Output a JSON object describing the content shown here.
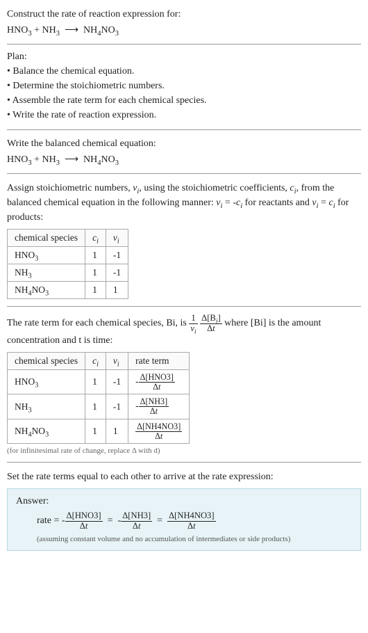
{
  "header": {
    "prompt": "Construct the rate of reaction expression for:",
    "equation": "HNO3 + NH3 ⟶ NH4NO3"
  },
  "plan": {
    "title": "Plan:",
    "items": [
      "Balance the chemical equation.",
      "Determine the stoichiometric numbers.",
      "Assemble the rate term for each chemical species.",
      "Write the rate of reaction expression."
    ]
  },
  "balanced": {
    "title": "Write the balanced chemical equation:",
    "equation": "HNO3 + NH3 ⟶ NH4NO3"
  },
  "stoich": {
    "intro1": "Assign stoichiometric numbers, νi, using the stoichiometric coefficients, ci, from the balanced chemical equation in the following manner: νi = -ci for reactants and νi = ci for products:",
    "headers": {
      "species": "chemical species",
      "ci": "ci",
      "vi": "νi"
    },
    "rows": [
      {
        "species": "HNO3",
        "ci": "1",
        "vi": "-1"
      },
      {
        "species": "NH3",
        "ci": "1",
        "vi": "-1"
      },
      {
        "species": "NH4NO3",
        "ci": "1",
        "vi": "1"
      }
    ]
  },
  "rateterms": {
    "intro_pre": "The rate term for each chemical species, Bi, is ",
    "intro_post": " where [Bi] is the amount concentration and t is time:",
    "headers": {
      "species": "chemical species",
      "ci": "ci",
      "vi": "νi",
      "rate": "rate term"
    },
    "rows": [
      {
        "species": "HNO3",
        "ci": "1",
        "vi": "-1",
        "num": "Δ[HNO3]",
        "den": "Δt",
        "sign": "-"
      },
      {
        "species": "NH3",
        "ci": "1",
        "vi": "-1",
        "num": "Δ[NH3]",
        "den": "Δt",
        "sign": "-"
      },
      {
        "species": "NH4NO3",
        "ci": "1",
        "vi": "1",
        "num": "Δ[NH4NO3]",
        "den": "Δt",
        "sign": ""
      }
    ],
    "caption": "(for infinitesimal rate of change, replace Δ with d)"
  },
  "final": {
    "title": "Set the rate terms equal to each other to arrive at the rate expression:",
    "answer_label": "Answer:",
    "rate_label": "rate = ",
    "assumption": "(assuming constant volume and no accumulation of intermediates or side products)"
  },
  "chart_data": {
    "type": "table",
    "title": "Stoichiometric coefficients and rate terms for HNO3 + NH3 → NH4NO3",
    "categories": [
      "HNO3",
      "NH3",
      "NH4NO3"
    ],
    "series": [
      {
        "name": "c_i",
        "values": [
          1,
          1,
          1
        ]
      },
      {
        "name": "ν_i",
        "values": [
          -1,
          -1,
          1
        ]
      }
    ],
    "rate_expression": "rate = -Δ[HNO3]/Δt = -Δ[NH3]/Δt = Δ[NH4NO3]/Δt"
  }
}
